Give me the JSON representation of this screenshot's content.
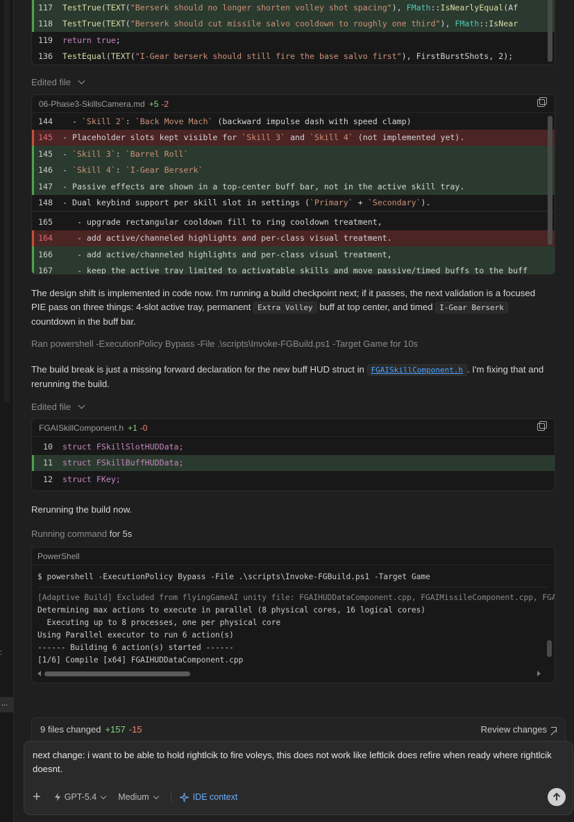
{
  "diff1": {
    "lines": [
      {
        "num": "117",
        "type": "added",
        "code": "TestTrue(TEXT(\"Berserk should no longer shorten volley shot spacing\"), FMath::IsNearlyEqual(Af"
      },
      {
        "num": "118",
        "type": "added",
        "code": "TestTrue(TEXT(\"Berserk should cut missile salvo cooldown to roughly one third\"), FMath::IsNear"
      },
      {
        "num": "119",
        "type": "normal",
        "code": "return true;"
      },
      {
        "num": "136",
        "type": "normal",
        "code": "TestEqual(TEXT(\"I-Gear berserk should still fire the base salvo first\"), FirstBurstShots, 2);"
      }
    ]
  },
  "edited1": {
    "label": "Edited file"
  },
  "diff2": {
    "filename": "06-Phase3-SkillsCamera.md",
    "added": "+5",
    "removed": "-2",
    "lines": [
      {
        "num": "144",
        "type": "normal",
        "code": "  - `Skill 2`: `Back Move Mach` (backward impulse dash with speed clamp)"
      },
      {
        "num": "145",
        "type": "removed",
        "code": "- Placeholder slots kept visible for `Skill 3` and `Skill 4` (not implemented yet)."
      },
      {
        "num": "145",
        "type": "added",
        "code": "- `Skill 3`: `Barrel Roll`"
      },
      {
        "num": "146",
        "type": "added",
        "code": "- `Skill 4`: `I-Gear Berserk`"
      },
      {
        "num": "147",
        "type": "added",
        "code": "- Passive effects are shown in a top-center buff bar, not in the active skill tray."
      },
      {
        "num": "148",
        "type": "normal",
        "code": "- Dual keybind support per skill slot in settings (`Primary` + `Secondary`)."
      },
      {
        "num": "165",
        "type": "normal",
        "code": "   - upgrade rectangular cooldown fill to ring cooldown treatment,"
      },
      {
        "num": "164",
        "type": "removed",
        "code": "   - add active/channeled highlights and per-class visual treatment."
      },
      {
        "num": "166",
        "type": "added",
        "code": "   - add active/channeled highlights and per-class visual treatment,"
      },
      {
        "num": "167",
        "type": "added",
        "code": "   - keep the active tray limited to activatable skills and move passive/timed buffs to the buff"
      }
    ]
  },
  "para1": {
    "text_a": "The design shift is implemented in code now. I'm running a build checkpoint next; if it passes, the next validation is a focused PIE pass on three things: 4-slot active tray, permanent ",
    "pill_a": "Extra Volley",
    "text_b": " buff at top center, and timed ",
    "pill_b": "I-Gear Berserk",
    "text_c": " countdown in the buff bar."
  },
  "ran1": {
    "text": "Ran powershell -ExecutionPolicy Bypass -File .\\scripts\\Invoke-FGBuild.ps1 -Target Game for 10s"
  },
  "para2": {
    "text_a": "The build break is just a missing forward declaration for the new buff HUD struct in ",
    "link": "FGAISkillComponent.h",
    "text_b": ". I'm fixing that and rerunning the build."
  },
  "edited2": {
    "label": "Edited file"
  },
  "diff3": {
    "filename": "FGAISkillComponent.h",
    "added": "+1",
    "removed": "-0",
    "lines": [
      {
        "num": "10",
        "type": "normal",
        "kw": "struct",
        "name": "FSkillSlotHUDData;"
      },
      {
        "num": "11",
        "type": "added",
        "kw": "struct",
        "name": "FSkillBuffHUDData;"
      },
      {
        "num": "12",
        "type": "normal",
        "kw": "struct",
        "name": "FKey;"
      }
    ]
  },
  "para3": {
    "text": "Rerunning the build now."
  },
  "running": {
    "prefix": "Running command",
    "suffix": "for 5s"
  },
  "terminal": {
    "title": "PowerShell",
    "command": "$ powershell -ExecutionPolicy Bypass -File .\\scripts\\Invoke-FGBuild.ps1 -Target Game",
    "lines": [
      "[Adaptive Build] Excluded from flyingGameAI unity file: FGAIHUDDataComponent.cpp, FGAIMissileComponent.cpp, FGA",
      "Determining max actions to execute in parallel (8 physical cores, 16 logical cores)",
      "  Executing up to 8 processes, one per physical core",
      "Using Parallel executor to run 6 action(s)",
      "------ Building 6 action(s) started ------",
      "[1/6] Compile [x64] FGAIHUDDataComponent.cpp"
    ]
  },
  "changes": {
    "label": "9 files changed",
    "added": "+157",
    "removed": "-15",
    "review": "Review changes"
  },
  "composer": {
    "message": "next change: i want to be able to hold rightlcik to fire voleys, this does not work like leftlcik does refire when ready where rightlcik doesnt.",
    "model": "GPT-5.4",
    "effort": "Medium",
    "context": "IDE context"
  }
}
